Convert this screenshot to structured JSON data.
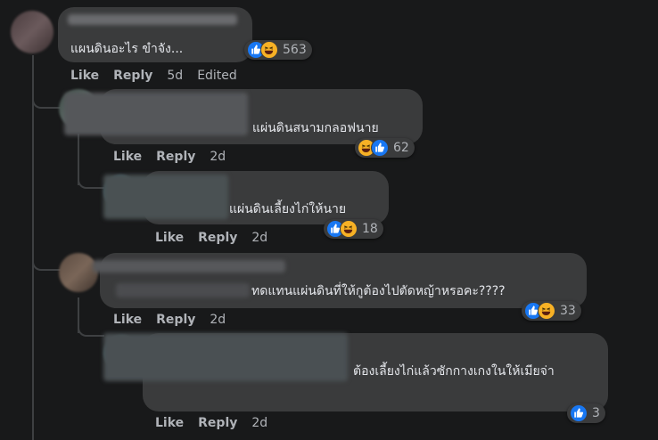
{
  "comments": [
    {
      "text": "แผนดินอะไร ขำจัง...",
      "like_label": "Like",
      "reply_label": "Reply",
      "time": "5d",
      "edited": "Edited",
      "reaction_count": "563",
      "reactions": [
        "like",
        "haha"
      ]
    },
    {
      "text": "แผ่นดินสนามกลอฟนาย",
      "like_label": "Like",
      "reply_label": "Reply",
      "time": "2d",
      "reaction_count": "62",
      "reactions": [
        "haha",
        "like"
      ]
    },
    {
      "text": "แผ่นดินเลี้ยงไก่ให้นาย",
      "like_label": "Like",
      "reply_label": "Reply",
      "time": "2d",
      "reaction_count": "18",
      "reactions": [
        "like",
        "haha"
      ]
    },
    {
      "text": "ทดแทนแผ่นดินที่ให้กูต้องไปตัดหญ้าหรอคะ????",
      "like_label": "Like",
      "reply_label": "Reply",
      "time": "2d",
      "reaction_count": "33",
      "reactions": [
        "like",
        "haha"
      ]
    },
    {
      "text": "ต้องเลี้ยงไก่แล้วซักกางเกงในให้เมียจ่า",
      "like_label": "Like",
      "reply_label": "Reply",
      "time": "2d",
      "reaction_count": "3",
      "reactions": [
        "like"
      ]
    }
  ],
  "colors": {
    "background": "#18191a",
    "bubble": "#3a3b3c",
    "like": "#1877f2",
    "haha": "#f7b125",
    "muted_text": "#b0b3b8"
  },
  "icons": [
    "like-icon",
    "haha-icon"
  ]
}
